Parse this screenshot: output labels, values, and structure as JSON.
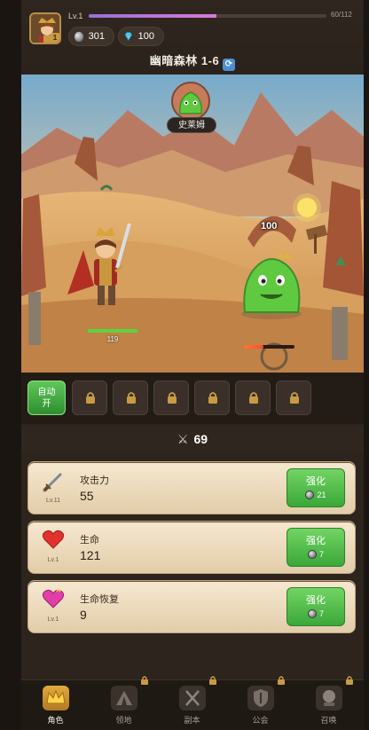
{
  "header": {
    "level_label": "Lv.1",
    "xp_text": "60/112",
    "xp_progress": 0.536,
    "avatar_level": "1",
    "silver": "301",
    "gems": "100",
    "stage_title": "幽暗森林 1-6"
  },
  "battle": {
    "enemy_name": "史莱姆",
    "damage_number": "100",
    "hero_hp_value": "119",
    "hero_hp_ratio": 1.0,
    "enemy_hp_ratio": 0.4
  },
  "skills": {
    "auto_label_top": "自动",
    "auto_label_bottom": "开",
    "locked_slots": 6
  },
  "power": {
    "value": "69"
  },
  "stats": [
    {
      "name": "攻击力",
      "value": "55",
      "level": "Lv.11",
      "icon": "sword-icon",
      "button": "强化",
      "cost": "21"
    },
    {
      "name": "生命",
      "value": "121",
      "level": "Lv.1",
      "icon": "heart-icon",
      "button": "强化",
      "cost": "7"
    },
    {
      "name": "生命恢复",
      "value": "9",
      "level": "Lv.1",
      "icon": "heart-regen-icon",
      "button": "强化",
      "cost": "7"
    }
  ],
  "nav": [
    {
      "label": "角色",
      "icon": "crown-icon",
      "active": true,
      "locked": false
    },
    {
      "label": "领地",
      "icon": "tent-icon",
      "active": false,
      "locked": true
    },
    {
      "label": "副本",
      "icon": "crossed-swords-icon",
      "active": false,
      "locked": true
    },
    {
      "label": "公会",
      "icon": "shield-icon",
      "active": false,
      "locked": true
    },
    {
      "label": "召唤",
      "icon": "summon-orb-icon",
      "active": false,
      "locked": true
    }
  ],
  "colors": {
    "accent_green": "#3aa83a",
    "xp_purple": "#b476d6",
    "card_bg": "#efdcbc"
  }
}
